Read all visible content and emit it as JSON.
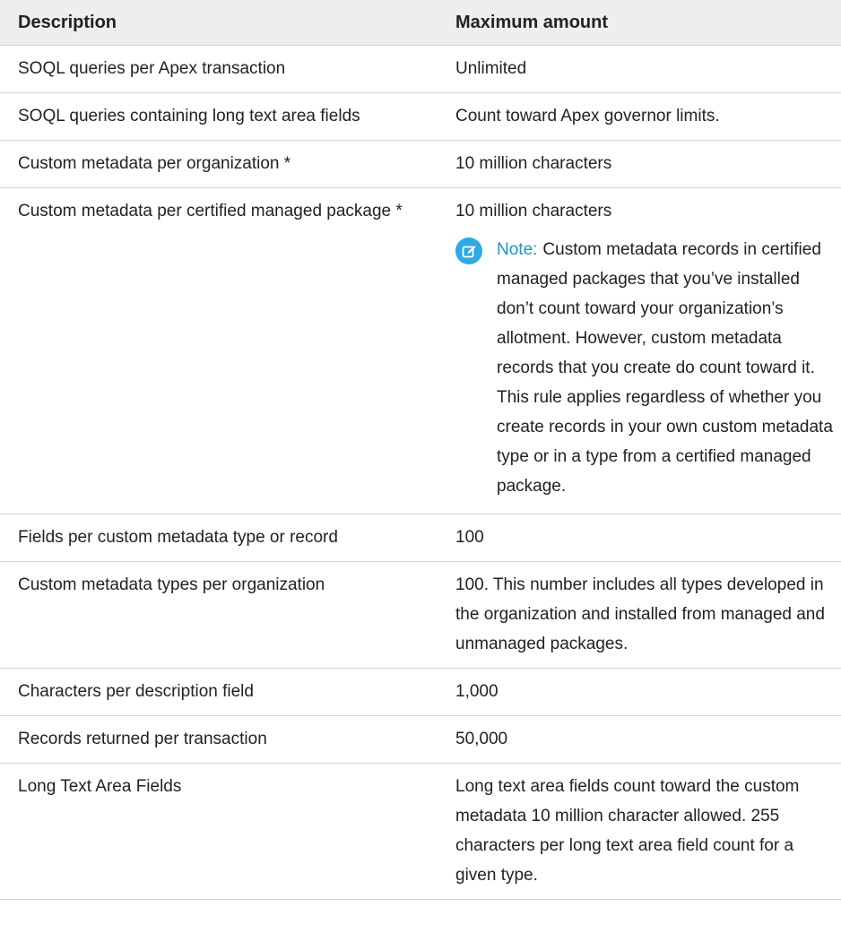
{
  "table": {
    "headers": {
      "description": "Description",
      "maximum": "Maximum amount"
    },
    "rows": [
      {
        "description": "SOQL queries per Apex transaction",
        "value": "Unlimited"
      },
      {
        "description": "SOQL queries containing long text area fields",
        "value": "Count toward Apex governor limits."
      },
      {
        "description": "Custom metadata per organization *",
        "value": "10 million characters"
      },
      {
        "description": "Custom metadata per certified managed package *",
        "value": "10 million characters",
        "note": {
          "label": "Note:",
          "text": "Custom metadata records in certified managed packages that you’ve installed don’t count toward your organization’s allotment. However, custom metadata records that you create do count toward it. This rule applies regardless of whether you create records in your own custom metadata type or in a type from a certified managed package.",
          "icon": "note-edit-icon",
          "accent_color": "#2ea8e6"
        }
      },
      {
        "description": "Fields per custom metadata type or record",
        "value": "100"
      },
      {
        "description": "Custom metadata types per organization",
        "value": "100. This number includes all types developed in the organization and installed from managed and unmanaged packages."
      },
      {
        "description": "Characters per description field",
        "value": "1,000"
      },
      {
        "description": "Records returned per transaction",
        "value": "50,000"
      },
      {
        "description": "Long Text Area Fields",
        "value": "Long text area fields count toward the custom metadata 10 million character allowed. 255 characters per long text area field count for a given type."
      }
    ]
  }
}
